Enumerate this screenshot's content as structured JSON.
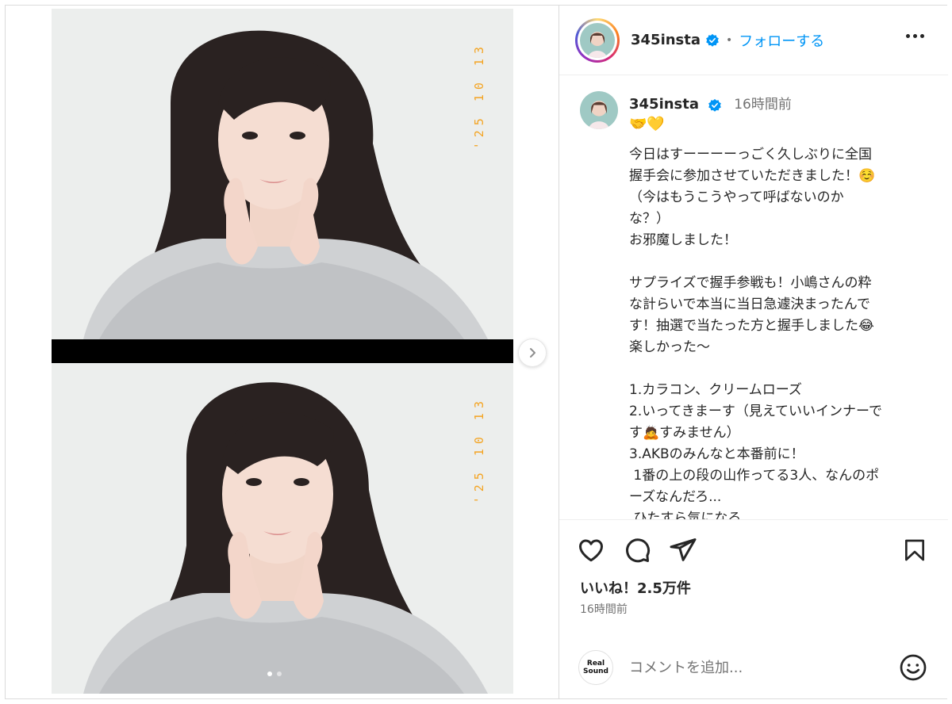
{
  "post": {
    "date_stamp": "'25 10 13",
    "carousel": {
      "slide_count": 2,
      "active_index": 0
    }
  },
  "header": {
    "username": "345insta",
    "separator": "•",
    "follow_label": "フォローする"
  },
  "caption": {
    "username": "345insta",
    "time": "16時間前",
    "emoji_line": "🤝💛",
    "text": "今日はすーーーーっごく久しぶりに全国\n握手会に参加させていただきました！☺️\n（今はもうこうやって呼ばないのか\nな？）\nお邪魔しました！\n\nサプライズで握手参戦も！小嶋さんの粋\nな計らいで本当に当日急遽決まったんで\nす！抽選で当たった方と握手しました😂\n楽しかった〜\n\n1.カラコン、クリームローズ\n2.いってきまーす（見えていいインナーで\nす🙇すみません）\n3.AKBのみんなと本番前に！\n 1番の上の段の山作ってる3人、なんのポ\nーズなんだろ...\n ひたすら気になる"
  },
  "actions": {
    "likes_label": "いいね！2.5万件",
    "post_time": "16時間前"
  },
  "comment": {
    "logo_text_line1": "Real",
    "logo_text_line2": "Sound",
    "placeholder": "コメントを追加..."
  },
  "colors": {
    "follow_blue": "#0095f6",
    "verified_blue": "#0095f6",
    "date_stamp_orange": "#f4a423",
    "text_primary": "#262626",
    "text_secondary": "#737373"
  }
}
